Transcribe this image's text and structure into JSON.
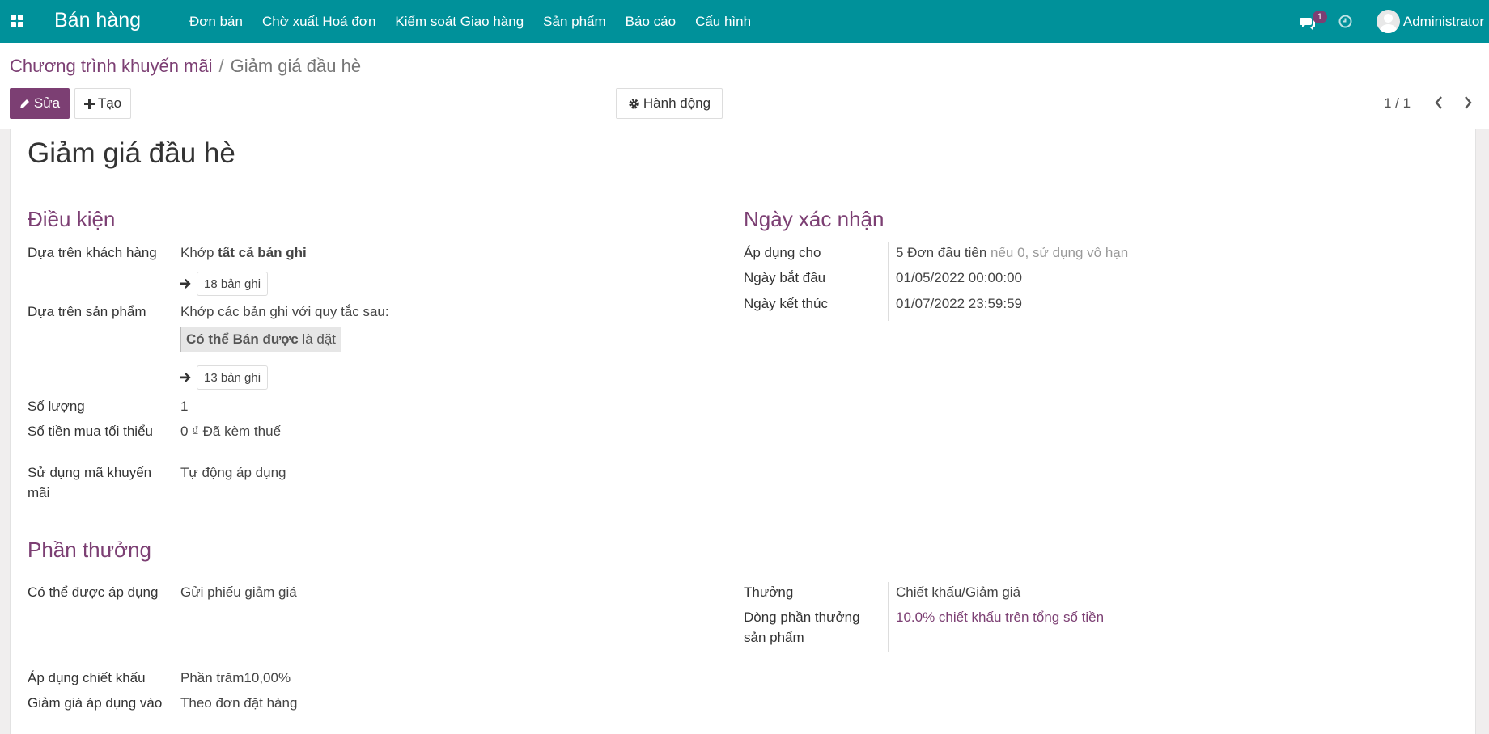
{
  "navbar": {
    "app_name": "Bán hàng",
    "menu": [
      "Đơn bán",
      "Chờ xuất Hoá đơn",
      "Kiểm soát Giao hàng",
      "Sản phẩm",
      "Báo cáo",
      "Cấu hình"
    ],
    "chat_count": "1",
    "user_name": "Administrator",
    "color": "#00919a"
  },
  "control_panel": {
    "breadcrumb_parent": "Chương trình khuyến mãi",
    "breadcrumb_sep": "/",
    "breadcrumb_current": "Giảm giá đầu hè",
    "edit_label": "Sửa",
    "create_label": "Tạo",
    "action_label": "Hành động",
    "pager": "1 / 1",
    "accent": "#7c3f73"
  },
  "form": {
    "title": "Giảm giá đầu hè",
    "conditions": {
      "heading": "Điều kiện",
      "customer_label": "Dựa trên khách hàng",
      "customer_match_prefix": "Khớp",
      "customer_match_bold": "tất cả bản ghi",
      "customer_records": "18 bản ghi",
      "product_label": "Dựa trên sản phẩm",
      "product_match": "Khớp các bản ghi với quy tắc sau:",
      "product_rule_field": "Có thể Bán được",
      "product_rule_op": "là đặt",
      "product_records": "13 bản ghi",
      "quantity_label": "Số lượng",
      "quantity_value": "1",
      "min_amount_label": "Số tiền mua tối thiểu",
      "min_amount_value": "0 ₫",
      "min_amount_tax": "Đã kèm thuế",
      "code_label": "Sử dụng mã khuyến mãi",
      "code_value": "Tự động áp dụng"
    },
    "validity": {
      "heading": "Ngày xác nhận",
      "apply_label": "Áp dụng cho",
      "apply_value": "5 Đơn đầu tiên",
      "apply_hint": "nếu 0, sử dụng vô hạn",
      "start_label": "Ngày bắt đầu",
      "start_value": "01/05/2022 00:00:00",
      "end_label": "Ngày kết thúc",
      "end_value": "01/07/2022 23:59:59"
    },
    "rewards": {
      "heading": "Phần thưởng",
      "applicable_label": "Có thể được áp dụng",
      "applicable_value": "Gửi phiếu giảm giá",
      "reward_label": "Thưởng",
      "reward_value": "Chiết khấu/Giảm giá",
      "reward_line_label": "Dòng phần thưởng sản phẩm",
      "reward_line_value": "10.0% chiết khấu trên tổng số tiền",
      "discount_label": "Áp dụng chiết khấu",
      "discount_value": "Phần trăm10,00%",
      "discount_on_label": "Giảm giá áp dụng vào",
      "discount_on_value": "Theo đơn đặt hàng"
    }
  }
}
